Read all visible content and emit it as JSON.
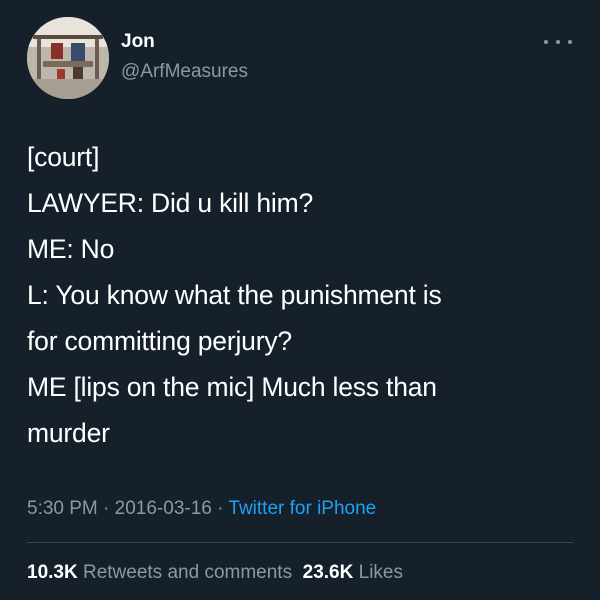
{
  "author": {
    "display_name": "Jon",
    "handle": "@ArfMeasures",
    "avatar_icon": "avatar-photo"
  },
  "menu": {
    "more_icon": "more-horizontal-icon"
  },
  "tweet": {
    "lines": [
      "[court]",
      "LAWYER: Did u kill him?",
      "ME: No",
      "L: You know what the punishment is",
      "for committing perjury?",
      "ME [lips on the mic] Much less than",
      "murder"
    ]
  },
  "meta": {
    "time": "5:30 PM",
    "separator": " · ",
    "date": "2016-03-16",
    "separator2": " · ",
    "source": "Twitter for iPhone"
  },
  "stats": {
    "retweets_count": "10.3K",
    "retweets_label": " Retweets and comments",
    "likes_count": "23.6K",
    "likes_label": " Likes"
  },
  "colors": {
    "background": "#15202b",
    "text_primary": "#ffffff",
    "text_secondary": "#8b98a5",
    "link": "#1da1f2",
    "divider": "#38444d"
  }
}
